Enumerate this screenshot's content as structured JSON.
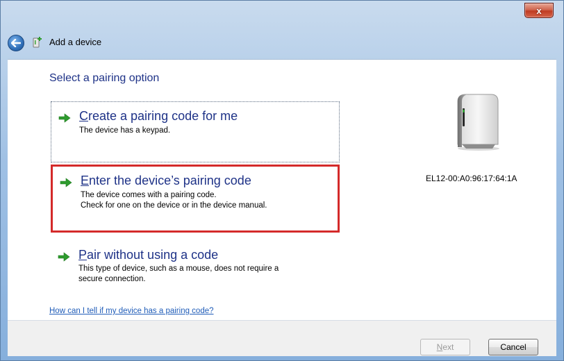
{
  "window": {
    "title": "Add a device",
    "close_glyph": "x"
  },
  "page": {
    "heading": "Select a pairing option",
    "options": [
      {
        "accesskey": "C",
        "title_rest": "reate a pairing code for me",
        "desc_line1": "The device has a keypad.",
        "desc_line2": ""
      },
      {
        "accesskey": "E",
        "title_rest": "nter the device’s pairing code",
        "desc_line1": "The device comes with a pairing code.",
        "desc_line2": "Check for one on the device or in the device manual."
      },
      {
        "accesskey": "P",
        "title_rest": "air without using a code",
        "desc_line1": "This type of device, such as a mouse, does not require a",
        "desc_line2": "secure connection."
      }
    ],
    "device_label": "EL12-00:A0:96:17:64:1A",
    "help_link": "How can I tell if my device has a pairing code?"
  },
  "footer": {
    "next_accesskey": "N",
    "next_rest": "ext",
    "cancel_label": "Cancel"
  },
  "icons": {
    "back": "back-arrow-icon",
    "title": "add-device-icon",
    "option_arrow": "green-arrow-icon",
    "device": "external-drive-icon"
  },
  "colors": {
    "accent_text": "#1e3287",
    "highlight_border": "#d42a2a",
    "link": "#1f5cb8",
    "arrow_green": "#2e9b2e"
  }
}
